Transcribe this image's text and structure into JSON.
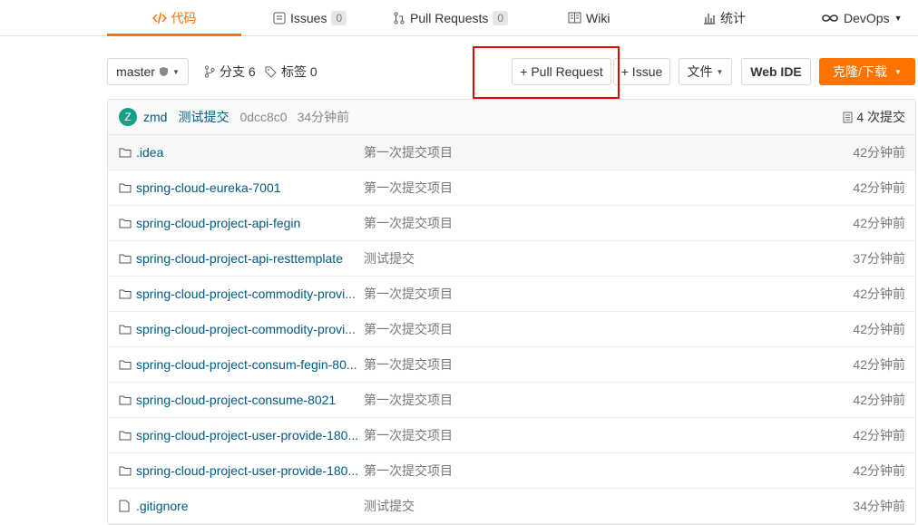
{
  "nav": {
    "code": "代码",
    "issues": "Issues",
    "issues_count": "0",
    "pull_requests": "Pull Requests",
    "pr_count": "0",
    "wiki": "Wiki",
    "stats": "统计",
    "devops": "DevOps"
  },
  "toolbar": {
    "branch": "master",
    "branches": "分支 6",
    "tags": "标签 0",
    "new_pr": "+ Pull Request",
    "new_issue": "+ Issue",
    "file": "文件",
    "web_ide": "Web IDE",
    "clone": "克隆/下载"
  },
  "commit": {
    "avatar": "Z",
    "author": "zmd",
    "message": "测试提交",
    "hash": "0dcc8c0",
    "time": "34分钟前",
    "count": "4 次提交"
  },
  "files": [
    {
      "name": ".idea",
      "message": "第一次提交项目",
      "time": "42分钟前"
    },
    {
      "name": "spring-cloud-eureka-7001",
      "message": "第一次提交项目",
      "time": "42分钟前"
    },
    {
      "name": "spring-cloud-project-api-fegin",
      "message": "第一次提交项目",
      "time": "42分钟前"
    },
    {
      "name": "spring-cloud-project-api-resttemplate",
      "message": "测试提交",
      "time": "37分钟前"
    },
    {
      "name": "spring-cloud-project-commodity-provi...",
      "message": "第一次提交项目",
      "time": "42分钟前"
    },
    {
      "name": "spring-cloud-project-commodity-provi...",
      "message": "第一次提交项目",
      "time": "42分钟前"
    },
    {
      "name": "spring-cloud-project-consum-fegin-80...",
      "message": "第一次提交项目",
      "time": "42分钟前"
    },
    {
      "name": "spring-cloud-project-consume-8021",
      "message": "第一次提交项目",
      "time": "42分钟前"
    },
    {
      "name": "spring-cloud-project-user-provide-180...",
      "message": "第一次提交项目",
      "time": "42分钟前"
    },
    {
      "name": "spring-cloud-project-user-provide-180...",
      "message": "第一次提交项目",
      "time": "42分钟前"
    },
    {
      "name": ".gitignore",
      "message": "测试提交",
      "time": "34分钟前"
    }
  ],
  "colors": {
    "accent": "#fe7300",
    "link": "#005980",
    "highlight": "#ee0000"
  }
}
